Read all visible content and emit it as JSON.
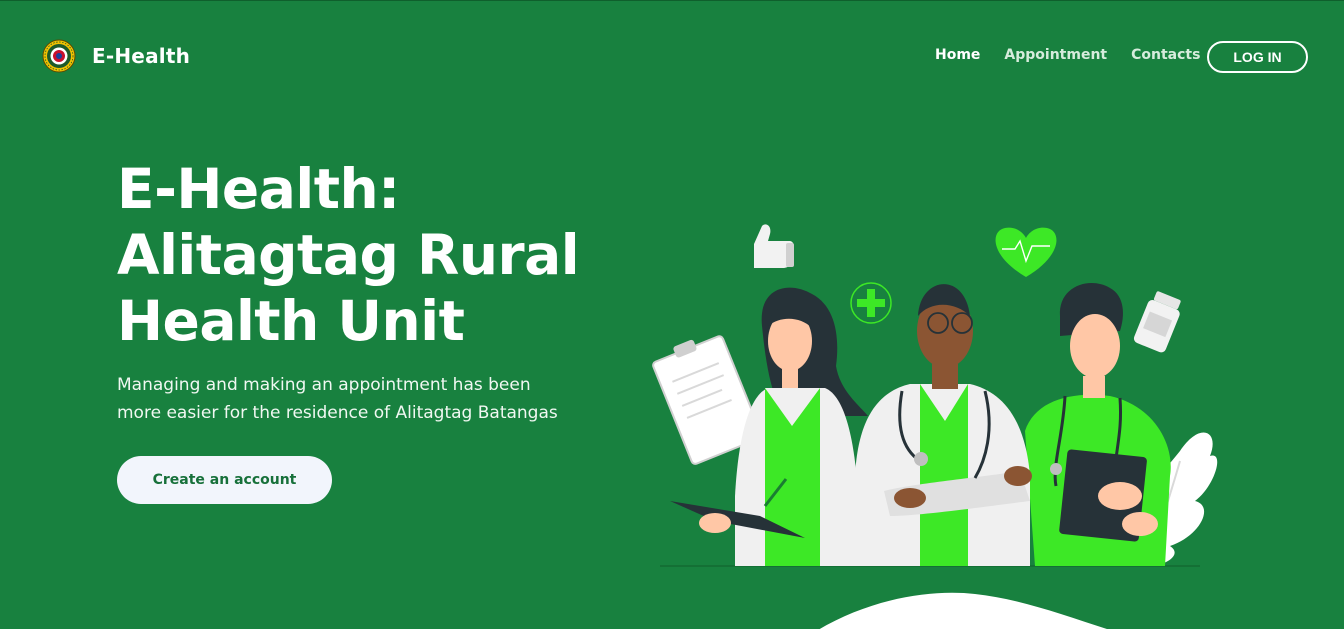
{
  "brand": {
    "name": "E-Health",
    "logo_icon": "seal-logo-icon"
  },
  "nav": {
    "items": [
      {
        "label": "Home",
        "active": true
      },
      {
        "label": "Appointment",
        "active": false
      },
      {
        "label": "Contacts",
        "active": false
      }
    ],
    "login_label": "LOG IN"
  },
  "hero": {
    "title_lines": [
      "E-Health:",
      "Alitagtag Rural",
      "Health Unit"
    ],
    "subtitle_lines": [
      "Managing and making an appointment has been",
      "more easier for the residence of Alitagtag Batangas"
    ],
    "cta_label": "Create an account"
  },
  "illustration": {
    "subject": "three-health-workers",
    "icons": [
      "thumbs-up-icon",
      "plus-icon",
      "heart-pulse-icon",
      "pill-bottle-icon",
      "clipboard-icon",
      "leaf-icon"
    ]
  },
  "colors": {
    "background": "#18813f",
    "accent_green": "#3de826",
    "text": "#ffffff",
    "cta_background": "#f2f5fc",
    "cta_text": "#17703a"
  }
}
